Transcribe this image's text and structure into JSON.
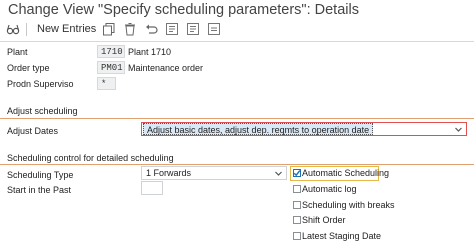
{
  "window": {
    "title": "Change View \"Specify scheduling parameters\": Details"
  },
  "toolbar": {
    "new_entries_label": "New Entries",
    "icons": [
      "glasses-icon",
      "copy-icon",
      "delete-icon",
      "undo-icon",
      "previous-entry-icon",
      "next-entry-icon",
      "save-icon"
    ]
  },
  "keys": {
    "plant": {
      "label": "Plant",
      "value": "1710",
      "description": "Plant 1710"
    },
    "order_type": {
      "label": "Order type",
      "value": "PM01",
      "description": "Maintenance order"
    },
    "prodn_supervisor": {
      "label": "Prodn Superviso",
      "value": "*"
    }
  },
  "adjust_scheduling": {
    "group_title": "Adjust scheduling",
    "adjust_dates_label": "Adjust Dates",
    "adjust_dates_value": "Adjust basic dates, adjust dep. reqmts to operation date"
  },
  "detailed_scheduling": {
    "group_title": "Scheduling control for detailed scheduling",
    "scheduling_type_label": "Scheduling Type",
    "scheduling_type_value": "1 Forwards",
    "start_in_past_label": "Start in the Past",
    "start_in_past_value": "",
    "checkboxes": [
      {
        "label": "Automatic Scheduling",
        "checked": true
      },
      {
        "label": "Automatic log",
        "checked": false
      },
      {
        "label": "Scheduling with breaks",
        "checked": false
      },
      {
        "label": "Shift Order",
        "checked": false
      },
      {
        "label": "Latest Staging Date",
        "checked": false
      }
    ]
  },
  "colors": {
    "group_line": "#e0a070",
    "focus_red": "#e05050",
    "highlight_border": "#e6b84a",
    "selected_text_bg": "#d9e8f6",
    "checkbox_check": "#1e6fb4"
  }
}
